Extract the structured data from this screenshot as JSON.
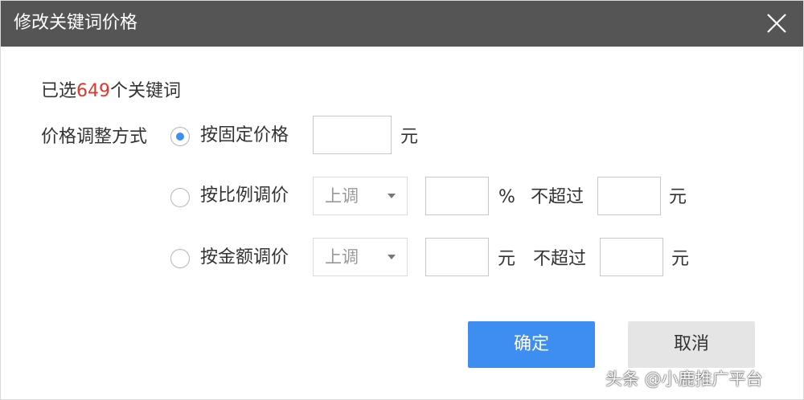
{
  "dialog": {
    "title": "修改关键词价格",
    "selected_prefix": "已选",
    "selected_count": "649",
    "selected_suffix": "个关键词",
    "method_label": "价格调整方式"
  },
  "options": {
    "fixed": {
      "label": "按固定价格",
      "checked": true,
      "value": "",
      "unit": "元"
    },
    "ratio": {
      "label": "按比例调价",
      "checked": false,
      "direction": "上调",
      "value": "",
      "unit": "%",
      "limit_label": "不超过",
      "limit_value": "",
      "limit_unit": "元"
    },
    "amount": {
      "label": "按金额调价",
      "checked": false,
      "direction": "上调",
      "value": "",
      "unit": "元",
      "limit_label": "不超过",
      "limit_value": "",
      "limit_unit": "元"
    }
  },
  "buttons": {
    "confirm": "确定",
    "cancel": "取消"
  },
  "watermark": "头条 @小鹿推广平台",
  "colors": {
    "titlebar": "#555555",
    "accent": "#3d8ef0",
    "count": "#e0372c",
    "cancel_bg": "#e5e5e5"
  },
  "icons": {
    "close": "close-icon",
    "dropdown": "chevron-down-icon"
  }
}
